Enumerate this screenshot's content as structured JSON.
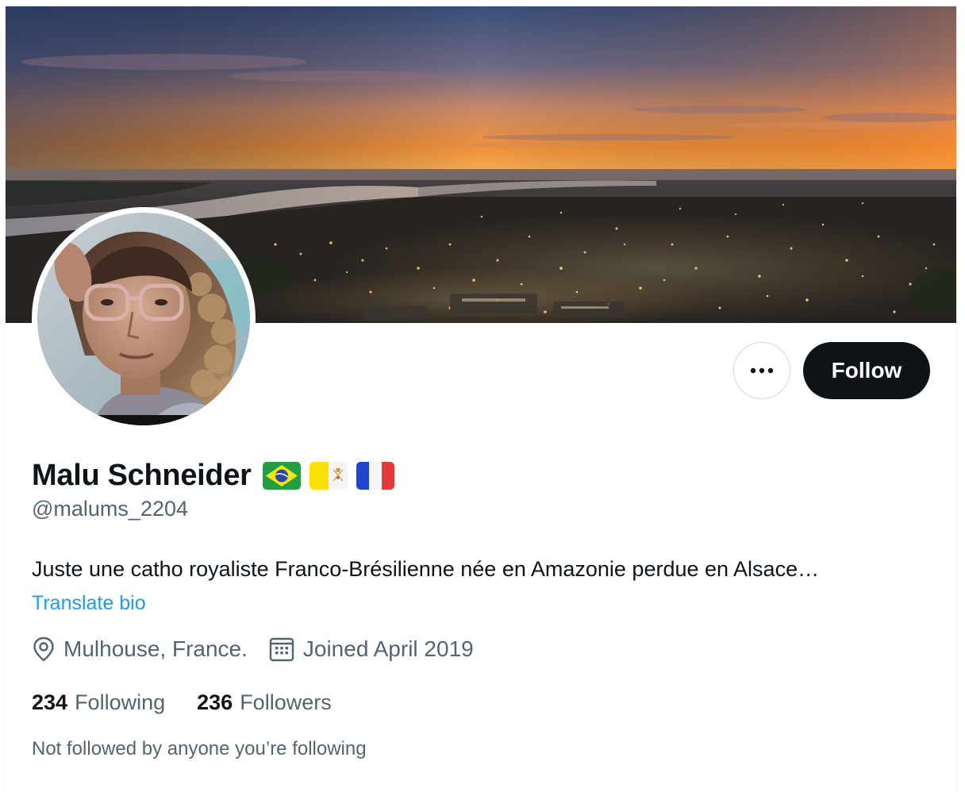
{
  "profile": {
    "display_name": "Malu Schneider",
    "flags": [
      "brazil-flag",
      "vatican-flag",
      "france-flag"
    ],
    "handle": "@malums_2204",
    "bio": "Juste une catho royaliste Franco-Brésilienne née en Amazonie perdue en Alsace…",
    "translate_bio": "Translate bio",
    "location": "Mulhouse, France.",
    "joined": "Joined April 2019",
    "following_count": "234",
    "following_label": "Following",
    "followers_count": "236",
    "followers_label": "Followers",
    "not_followed_text": "Not followed by anyone you’re following"
  },
  "actions": {
    "more_icon": "more-horizontal-icon",
    "follow_label": "Follow"
  },
  "icons": {
    "location": "location-pin-icon",
    "calendar": "calendar-icon"
  },
  "colors": {
    "text_primary": "#0f1419",
    "text_secondary": "#536471",
    "link": "#1d9bf0",
    "follow_bg": "#0f1419",
    "border": "#cfd9de"
  }
}
